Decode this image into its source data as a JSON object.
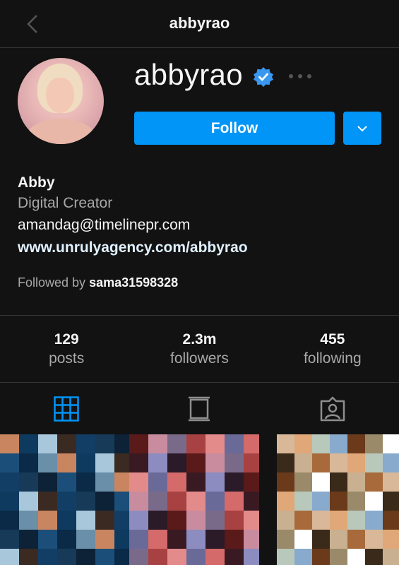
{
  "header": {
    "title": "abbyrao",
    "back_icon": "chevron-left-icon"
  },
  "profile": {
    "username": "abbyrao",
    "verified": true,
    "follow_label": "Follow",
    "bio": {
      "name": "Abby",
      "category": "Digital Creator",
      "email": "amandag@timelinepr.com",
      "link": "www.unrulyagency.com/abbyrao"
    },
    "followed_by": {
      "prefix": "Followed by",
      "user": "sama31598328"
    }
  },
  "stats": [
    {
      "value": "129",
      "label": "posts"
    },
    {
      "value": "2.3m",
      "label": "followers"
    },
    {
      "value": "455",
      "label": "following"
    }
  ],
  "tabs": [
    {
      "icon": "grid-icon",
      "active": true
    },
    {
      "icon": "reels-icon",
      "active": false
    },
    {
      "icon": "tagged-icon",
      "active": false
    }
  ],
  "colors": {
    "accent": "#0095f6",
    "background": "#121212",
    "divider": "#363636",
    "muted": "#a8a8a8"
  }
}
